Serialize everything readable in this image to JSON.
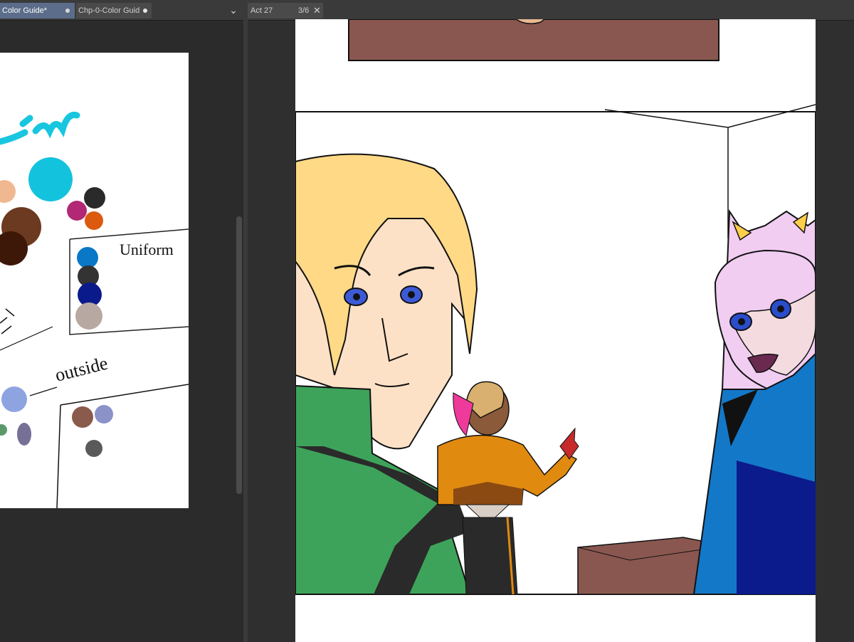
{
  "left_pane": {
    "tabs": [
      {
        "label": "Color Guide*",
        "active": true
      },
      {
        "label": "Chp-0-Color Guid",
        "active": false
      }
    ],
    "canvas_text": {
      "word1": "Uniform",
      "word2": "outside"
    }
  },
  "right_pane": {
    "tab": {
      "label": "Act 27",
      "page": "3/6"
    }
  },
  "colors": {
    "ui_bg": "#2b2b2b",
    "active_tab": "#5b6d8a",
    "cyan": "#13c3dd",
    "blue": "#1478c8",
    "navy": "#0b1b8c",
    "green": "#3ea35a",
    "orange": "#e08a10",
    "pink_hair": "#f1cdf2",
    "blonde": "#ffd986",
    "skin": "#fde1c6",
    "box": "#8a5750"
  },
  "icons": [
    "dot-icon",
    "chevron-down-icon",
    "close-icon"
  ]
}
